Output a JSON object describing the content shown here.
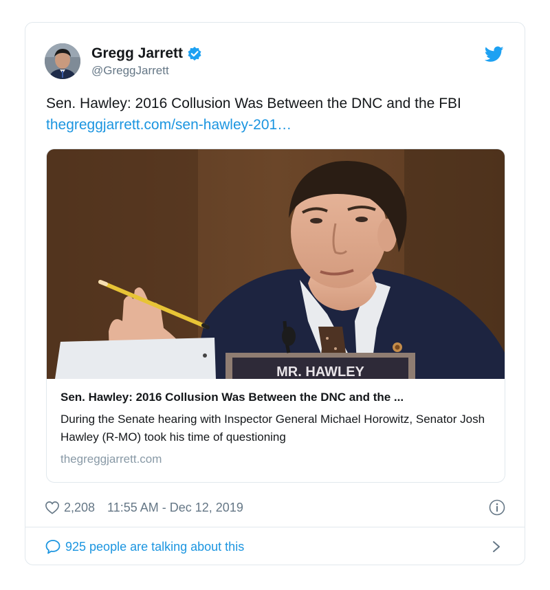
{
  "author": {
    "display_name": "Gregg Jarrett",
    "handle": "@GreggJarrett",
    "verified": true
  },
  "tweet": {
    "text": "Sen. Hawley: 2016 Collusion Was Between the DNC and the FBI ",
    "link_text": "thegreggjarrett.com/sen-hawley-201…"
  },
  "link_card": {
    "nameplate_text": "MR. HAWLEY",
    "title": "Sen. Hawley: 2016 Collusion Was Between the DNC and the ...",
    "description": "During the Senate hearing with Inspector General Michael Horowitz, Senator Josh Hawley (R-MO) took his time of questioning",
    "domain": "thegreggjarrett.com"
  },
  "meta": {
    "likes": "2,208",
    "timestamp": "11:55 AM - Dec 12, 2019"
  },
  "footer": {
    "talking_text": "925 people are talking about this"
  },
  "icons": {
    "verified": "verified-badge-icon",
    "twitter": "twitter-bird-icon",
    "heart": "heart-icon",
    "info": "info-icon",
    "comment": "speech-bubble-icon",
    "chevron": "chevron-right-icon"
  },
  "colors": {
    "link_blue": "#1b95e0",
    "secondary_text": "#657786",
    "border": "#e1e8ed"
  }
}
